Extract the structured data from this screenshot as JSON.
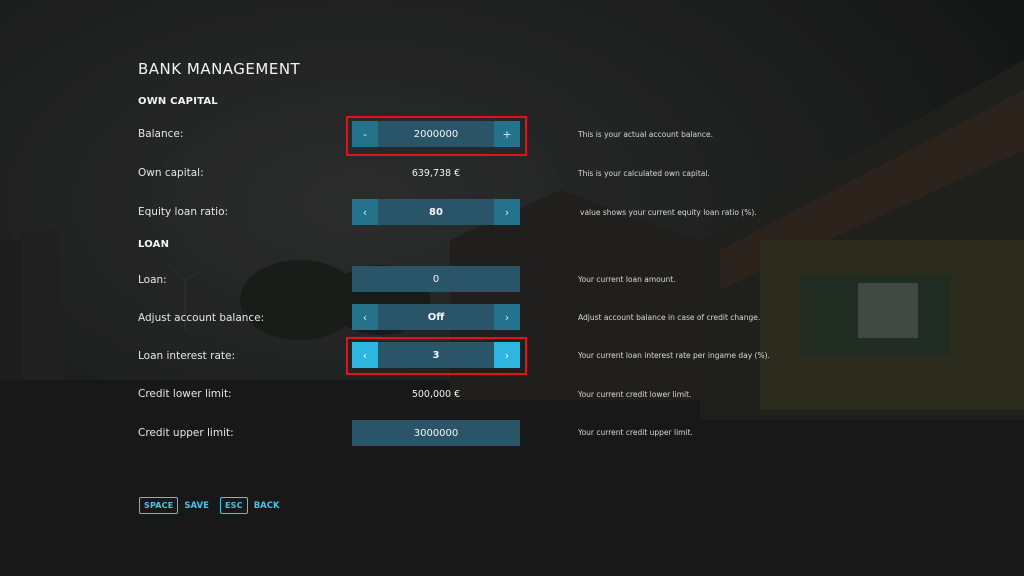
{
  "page": {
    "title": "BANK MANAGEMENT"
  },
  "sections": {
    "own_capital": "OWN CAPITAL",
    "loan": "LOAN"
  },
  "rows": {
    "balance": {
      "label": "Balance:",
      "value": "2000000",
      "minus": "-",
      "plus": "+",
      "desc": "This is your actual account balance."
    },
    "own_capital": {
      "label": "Own capital:",
      "value": "639,738 €",
      "desc": "This is your calculated own capital."
    },
    "equity_ratio": {
      "label": "Equity loan ratio:",
      "value": "80",
      "desc": "value shows your current equity loan ratio (%)."
    },
    "loan": {
      "label": "Loan:",
      "value": "0",
      "desc": "Your current loan amount."
    },
    "adjust_balance": {
      "label": "Adjust account balance:",
      "value": "Off",
      "desc": "Adjust account balance in case of credit change."
    },
    "interest_rate": {
      "label": "Loan interest rate:",
      "value": "3",
      "desc": "Your current loan interest rate per ingame day (%)."
    },
    "credit_lower": {
      "label": "Credit lower limit:",
      "value": "500,000 €",
      "desc": "Your current credit lower limit."
    },
    "credit_upper": {
      "label": "Credit upper limit:",
      "value": "3000000",
      "desc": "Your current credit upper limit."
    }
  },
  "icons": {
    "arrow_left": "‹",
    "arrow_right": "›"
  },
  "footer": {
    "save_key": "SPACE",
    "save_label": "SAVE",
    "back_key": "ESC",
    "back_label": "BACK"
  },
  "colors": {
    "accent": "#4fc3e6",
    "control_bg": "#2a5468",
    "control_btn": "#24728c",
    "control_btn_active": "#2cb6e0",
    "highlight": "#e0121b"
  }
}
